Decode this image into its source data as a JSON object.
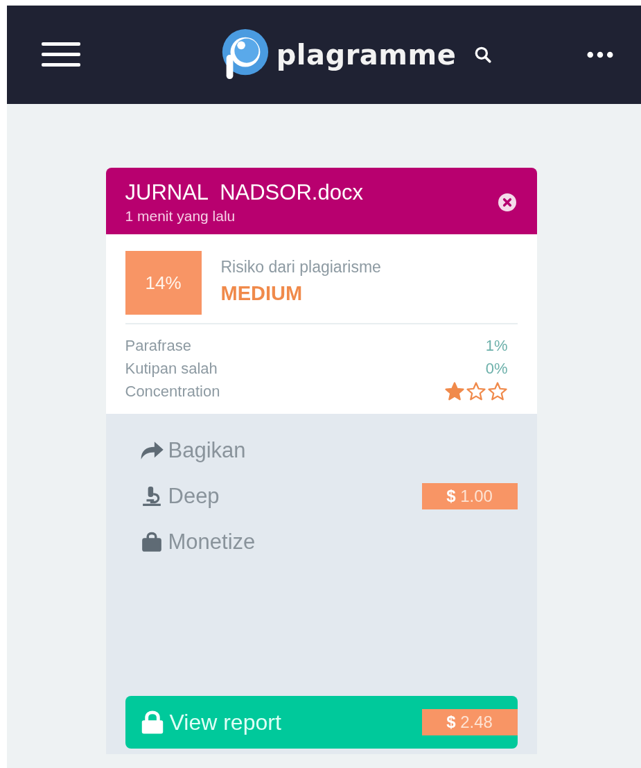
{
  "header": {
    "brand": "plagramme"
  },
  "document": {
    "title": "JURNAL  NADSOR.docx",
    "time": "1 menit yang lalu"
  },
  "risk": {
    "percent": "14%",
    "label": "Risiko dari plagiarisme",
    "level_text": "MEDIUM"
  },
  "metrics": [
    {
      "kind": "value",
      "label": "Parafrase",
      "value": "1%"
    },
    {
      "kind": "value",
      "label": "Kutipan salah",
      "value": "0%"
    },
    {
      "kind": "stars",
      "label": "Concentration",
      "stars": 1
    }
  ],
  "actions": [
    {
      "kind": "share",
      "label": "Bagikan"
    },
    {
      "kind": "deep",
      "label": "Deep",
      "price": "**$** 1.00"
    },
    {
      "kind": "monetize",
      "label": "Monetize"
    }
  ],
  "report_button": {
    "label": "View report",
    "price": "**$** 2.48"
  }
}
